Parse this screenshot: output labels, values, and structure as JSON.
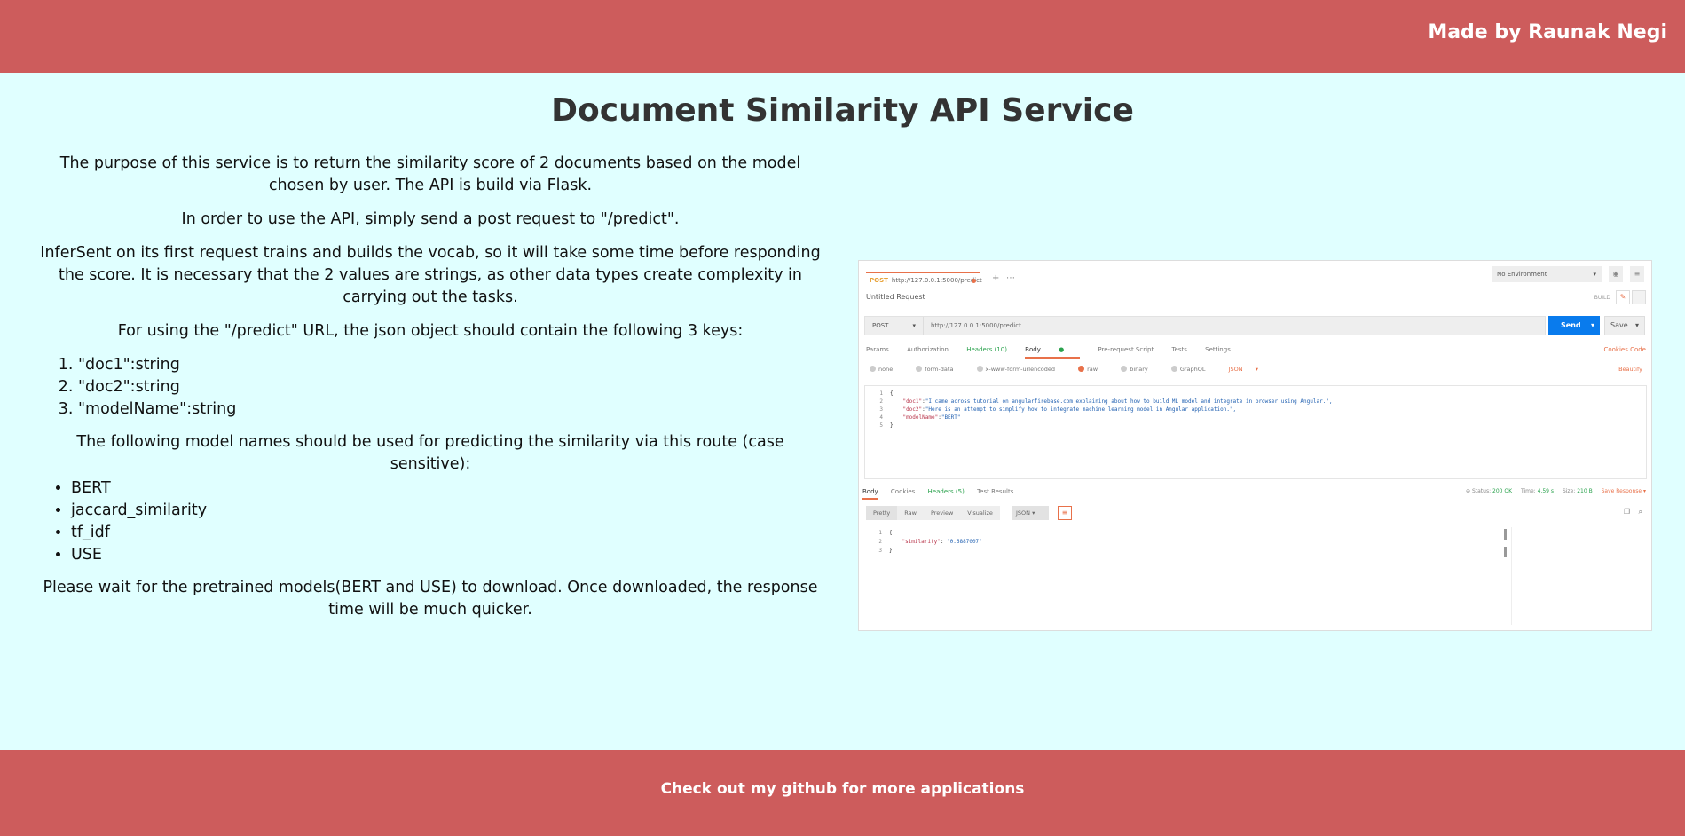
{
  "header": {
    "author": "Made by Raunak Negi"
  },
  "page": {
    "title": "Document Similarity API Service"
  },
  "content": {
    "intro": "The purpose of this service is to return the similarity score of 2 documents based on the model chosen by user. The API is build via Flask.",
    "usage": "In order to use the API, simply send a post request to \"/predict\".",
    "infersent_note": "InferSent on its first request trains and builds the vocab, so it will take some time before responding the score. It is necessary that the 2 values are strings, as other data types create complexity in carrying out the tasks.",
    "keys_intro": "For using the \"/predict\" URL, the json object should contain the following 3 keys:",
    "keys": [
      "\"doc1\":string",
      "\"doc2\":string",
      "\"modelName\":string"
    ],
    "models_intro": "The following model names should be used for predicting the similarity via this route (case sensitive):",
    "models": [
      "BERT",
      "jaccard_similarity",
      "tf_idf",
      "USE"
    ],
    "wait_note": "Please wait for the pretrained models(BERT and USE) to download. Once downloaded, the response time will be much quicker."
  },
  "screenshot": {
    "tab_method": "POST",
    "tab_url": "http://127.0.0.1:5000/predict",
    "environment": "No Environment",
    "request_name": "Untitled Request",
    "build": "BUILD",
    "method": "POST",
    "url": "http://127.0.0.1:5000/predict",
    "send": "Send",
    "save": "Save",
    "req_tabs": [
      "Params",
      "Authorization",
      "Headers (10)",
      "Body",
      "Pre-request Script",
      "Tests",
      "Settings"
    ],
    "cookies_code": "Cookies  Code",
    "body_options": [
      "none",
      "form-data",
      "x-www-form-urlencoded",
      "raw",
      "binary",
      "GraphQL"
    ],
    "body_format": "JSON",
    "beautify": "Beautify",
    "request_lines": {
      "l2_key": "\"doc1\"",
      "l2_val": "\"I came across tutorial on angularfirebase.com explaining about how to build ML model and integrate in browser using Angular.\",",
      "l3_key": "\"doc2\"",
      "l3_val": "\"Here is an attempt to simplify how to integrate machine learning model in Angular application.\",",
      "l4_key": "\"modelName\"",
      "l4_val": "\"BERT\""
    },
    "resp_tabs": [
      "Body",
      "Cookies",
      "Headers (5)",
      "Test Results"
    ],
    "status_label": "Status:",
    "status_value": "200 OK",
    "time_label": "Time:",
    "time_value": "4.59 s",
    "size_label": "Size:",
    "size_value": "210 B",
    "save_response": "Save Response",
    "view_tabs": [
      "Pretty",
      "Raw",
      "Preview",
      "Visualize"
    ],
    "resp_format": "JSON",
    "response_key": "\"similarity\"",
    "response_val": "\"0.6887007\""
  },
  "footer": {
    "link": "Check out my github for more applications"
  },
  "colors": {
    "bar": "#CD5C5C",
    "background": "#E0FFFF",
    "send": "#097BED",
    "accent": "#E8714A"
  }
}
